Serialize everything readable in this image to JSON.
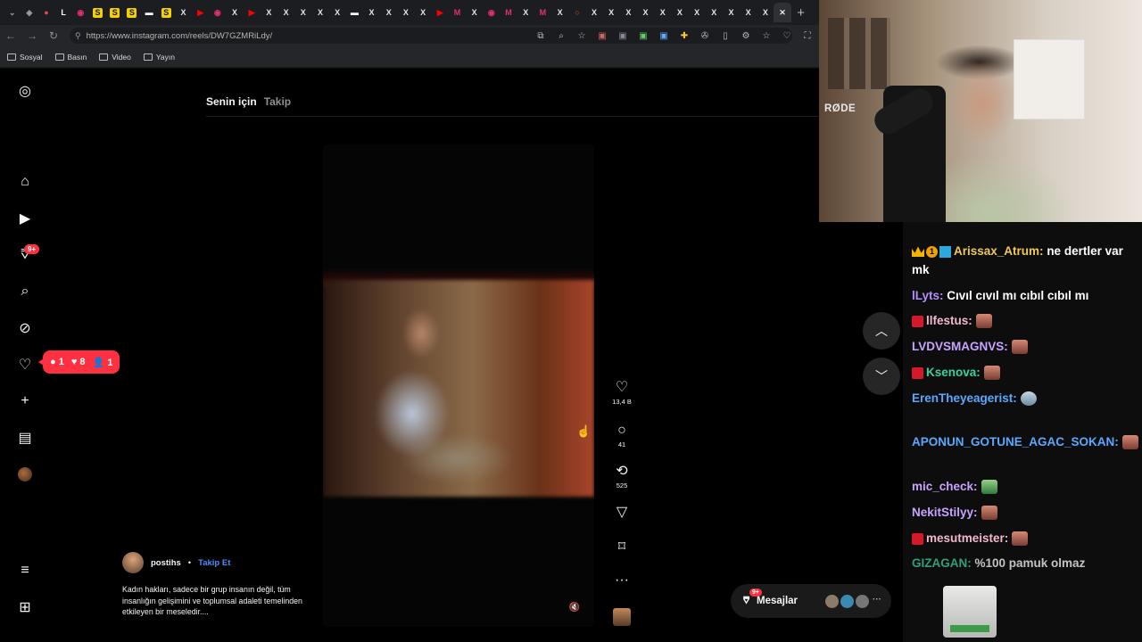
{
  "browser": {
    "tabs": [
      {
        "glyph": "⌄",
        "color": "#9aa0a6",
        "bg": "transparent"
      },
      {
        "glyph": "◈",
        "color": "#9aa0a6",
        "bg": "transparent"
      },
      {
        "glyph": "●",
        "color": "#e84545",
        "bg": "transparent"
      },
      {
        "glyph": "L",
        "color": "#ffffff",
        "bg": "transparent"
      },
      {
        "glyph": "◉",
        "color": "#e1306c",
        "bg": "transparent"
      },
      {
        "glyph": "S",
        "color": "#111111",
        "bg": "#f5d000"
      },
      {
        "glyph": "S",
        "color": "#111111",
        "bg": "#f5d000"
      },
      {
        "glyph": "S",
        "color": "#111111",
        "bg": "#f5d000"
      },
      {
        "glyph": "▬",
        "color": "#ffffff",
        "bg": "transparent"
      },
      {
        "glyph": "S",
        "color": "#111111",
        "bg": "#f5d000"
      },
      {
        "glyph": "X",
        "color": "#e6e6e6",
        "bg": "transparent"
      },
      {
        "glyph": "▶",
        "color": "#ff0000",
        "bg": "transparent"
      },
      {
        "glyph": "◉",
        "color": "#e1306c",
        "bg": "transparent"
      },
      {
        "glyph": "X",
        "color": "#e6e6e6",
        "bg": "transparent"
      },
      {
        "glyph": "▶",
        "color": "#ff0000",
        "bg": "transparent"
      },
      {
        "glyph": "X",
        "color": "#e6e6e6",
        "bg": "transparent"
      },
      {
        "glyph": "X",
        "color": "#e6e6e6",
        "bg": "transparent"
      },
      {
        "glyph": "X",
        "color": "#e6e6e6",
        "bg": "transparent"
      },
      {
        "glyph": "X",
        "color": "#e6e6e6",
        "bg": "transparent"
      },
      {
        "glyph": "X",
        "color": "#e6e6e6",
        "bg": "transparent"
      },
      {
        "glyph": "▬",
        "color": "#ffffff",
        "bg": "transparent"
      },
      {
        "glyph": "X",
        "color": "#e6e6e6",
        "bg": "transparent"
      },
      {
        "glyph": "X",
        "color": "#e6e6e6",
        "bg": "transparent"
      },
      {
        "glyph": "X",
        "color": "#e6e6e6",
        "bg": "transparent"
      },
      {
        "glyph": "X",
        "color": "#e6e6e6",
        "bg": "transparent"
      },
      {
        "glyph": "▶",
        "color": "#ff0000",
        "bg": "transparent"
      },
      {
        "glyph": "M",
        "color": "#e1306c",
        "bg": "transparent"
      },
      {
        "glyph": "X",
        "color": "#e6e6e6",
        "bg": "transparent"
      },
      {
        "glyph": "◉",
        "color": "#e1306c",
        "bg": "transparent"
      },
      {
        "glyph": "M",
        "color": "#e1306c",
        "bg": "transparent"
      },
      {
        "glyph": "X",
        "color": "#e6e6e6",
        "bg": "transparent"
      },
      {
        "glyph": "M",
        "color": "#e1306c",
        "bg": "transparent"
      },
      {
        "glyph": "X",
        "color": "#e6e6e6",
        "bg": "transparent"
      },
      {
        "glyph": "○",
        "color": "#e25822",
        "bg": "transparent"
      },
      {
        "glyph": "X",
        "color": "#e6e6e6",
        "bg": "transparent"
      },
      {
        "glyph": "X",
        "color": "#e6e6e6",
        "bg": "transparent"
      },
      {
        "glyph": "X",
        "color": "#e6e6e6",
        "bg": "transparent"
      },
      {
        "glyph": "X",
        "color": "#e6e6e6",
        "bg": "transparent"
      },
      {
        "glyph": "X",
        "color": "#e6e6e6",
        "bg": "transparent"
      },
      {
        "glyph": "X",
        "color": "#e6e6e6",
        "bg": "transparent"
      },
      {
        "glyph": "X",
        "color": "#e6e6e6",
        "bg": "transparent"
      },
      {
        "glyph": "X",
        "color": "#e6e6e6",
        "bg": "transparent"
      },
      {
        "glyph": "X",
        "color": "#e6e6e6",
        "bg": "transparent"
      },
      {
        "glyph": "X",
        "color": "#e6e6e6",
        "bg": "transparent"
      },
      {
        "glyph": "X",
        "color": "#e6e6e6",
        "bg": "transparent"
      },
      {
        "glyph": "✕",
        "color": "#e6e6e6",
        "bg": "#2e3036",
        "active": true
      }
    ],
    "new_tab": "+",
    "url": "https://www.instagram.com/reels/DW7GZMRiLdy/",
    "bookmarks": [
      "Sosyal",
      "Basın",
      "Video",
      "Yayın"
    ]
  },
  "instagram": {
    "feed_tabs": {
      "active": "Senin için",
      "inactive": "Takip"
    },
    "sidebar_badge": "9+",
    "notifications": {
      "comments": "1",
      "likes": "8",
      "follows": "1"
    },
    "actions": {
      "likes": "13,4 B",
      "comments": "41",
      "reposts": "525"
    },
    "author": {
      "name": "postihs",
      "separator": "•",
      "follow": "Takip Et"
    },
    "caption": "Kadın hakları, sadece bir grup insanın değil, tüm insanlığın gelişimini ve toplumsal adaleti temelinden etkileyen bir meseledir....",
    "messages": {
      "label": "Mesajlar",
      "badge": "9+"
    }
  },
  "overlay": {
    "mic_brand": "RØDE",
    "chat": [
      {
        "user": "Arissax_Atrum:",
        "msg": "ne dertler var mk",
        "color": "#f0c85a",
        "badges": [
          "crown",
          "num1",
          "sub"
        ]
      },
      {
        "user": "lLyts:",
        "msg": "Cıvıl cıvıl mı cıbıl cıbıl mı",
        "color": "#b48cff",
        "badges": []
      },
      {
        "user": "llfestus:",
        "msg": "",
        "color": "#f2b8d0",
        "badges": [
          "redb"
        ],
        "emote": "face"
      },
      {
        "user": "LVDVSMAGNVS:",
        "msg": "",
        "color": "#c8a2ff",
        "badges": [],
        "emote": "face"
      },
      {
        "user": "Ksenova:",
        "msg": "",
        "color": "#3ad29f",
        "badges": [
          "redb"
        ],
        "emote": "face"
      },
      {
        "user": "ErenTheyeagerist:",
        "msg": "",
        "color": "#5aa8ff",
        "badges": [],
        "emote": "robot"
      },
      {
        "user": "APONUN_GOTUNE_AGAC_SOKAN:",
        "msg": "",
        "color": "#5aa8ff",
        "badges": [],
        "emote": "face"
      },
      {
        "user": "mic_check:",
        "msg": "",
        "color": "#c8a2ff",
        "badges": [],
        "emote": "green"
      },
      {
        "user": "NekitStilyy:",
        "msg": "",
        "color": "#c8a2ff",
        "badges": [],
        "emote": "face"
      },
      {
        "user": "mesutmeister:",
        "msg": "",
        "color": "#f2b8d0",
        "badges": [
          "redb"
        ],
        "emote": "face"
      },
      {
        "user": "GIZAGAN:",
        "msg": "%100 pamuk olmaz",
        "color": "#3ad29f",
        "badges": [],
        "dim": true
      }
    ]
  }
}
